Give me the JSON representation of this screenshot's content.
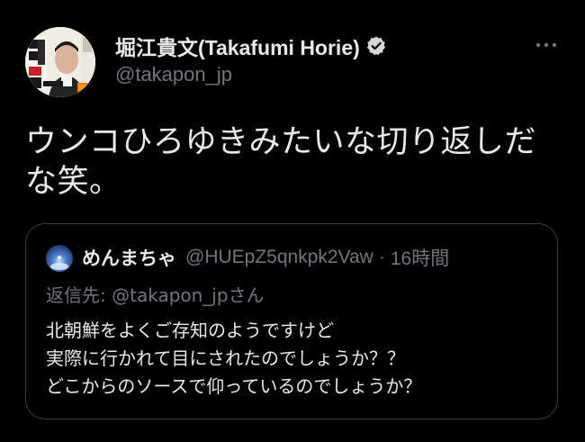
{
  "author": {
    "display_name": "堀江貴文(Takafumi Horie)",
    "handle": "@takapon_jp",
    "avatar_icon": "author-avatar",
    "verified_icon": "verified-badge-icon"
  },
  "more_icon": "more-options-icon",
  "tweet": {
    "text_line1": "ウンコひろゆきみたいな切り返しだ",
    "text_line2": "な笑。"
  },
  "quoted": {
    "display_name": "めんまちゃ",
    "handle": "@HUEpZ5qnkpk2Vaw",
    "separator": "·",
    "time": "16時間",
    "reply_prefix": "返信先: ",
    "reply_handle": "@takapon_jp",
    "reply_suffix": "さん",
    "body_lines": [
      "北朝鮮をよくご存知のようですけど",
      "実際に行かれて目にされたのでしょうか？？",
      "どこからのソースで仰っているのでしょうか？"
    ]
  },
  "colors": {
    "background": "#000000",
    "primary_text": "#e7e9ea",
    "secondary_text": "#71767b",
    "border": "#3a3d41"
  }
}
